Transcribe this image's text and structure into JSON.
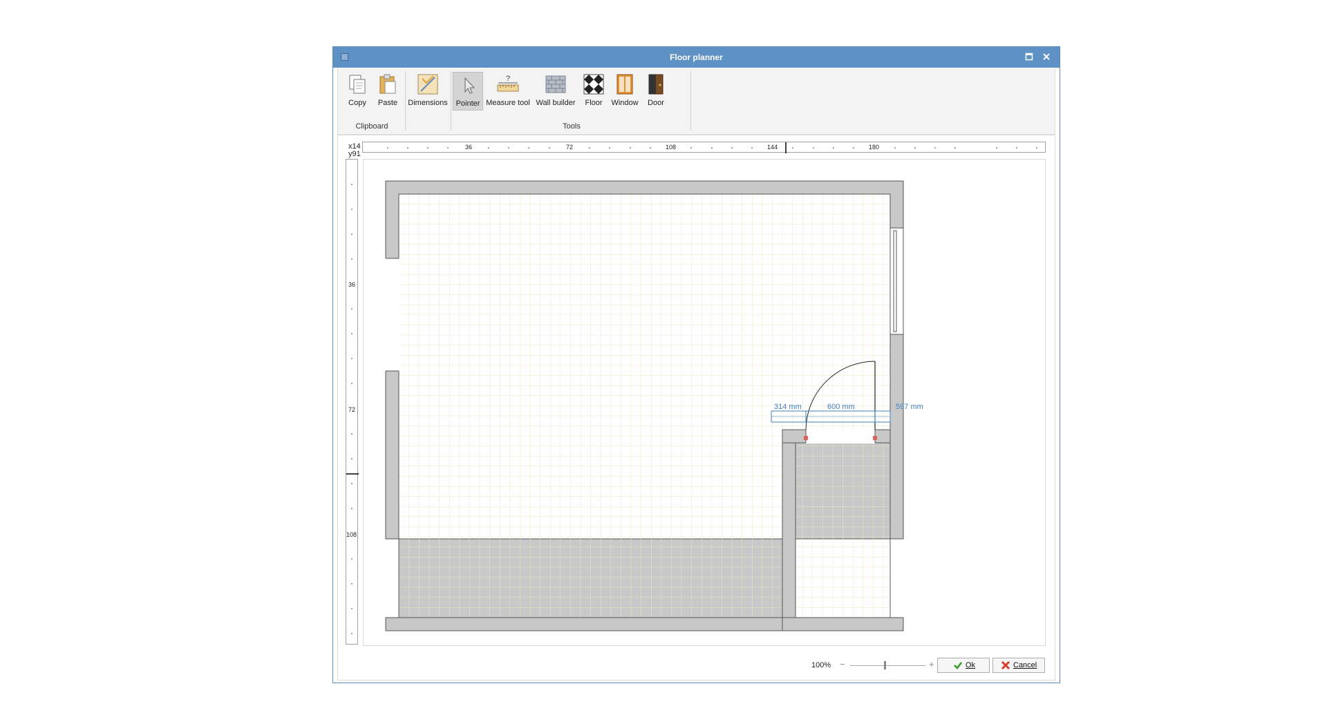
{
  "window": {
    "title": "Floor planner"
  },
  "ribbon": {
    "buttons": [
      {
        "label": "Copy",
        "icon": "copy-icon"
      },
      {
        "label": "Paste",
        "icon": "paste-icon"
      },
      {
        "label": "Dimensions",
        "icon": "dimensions-icon"
      },
      {
        "label": "Pointer",
        "icon": "pointer-icon",
        "active": true
      },
      {
        "label": "Measure tool",
        "icon": "measure-tool-icon"
      },
      {
        "label": "Wall builder",
        "icon": "wall-builder-icon"
      },
      {
        "label": "Floor",
        "icon": "floor-icon"
      },
      {
        "label": "Window",
        "icon": "window-icon"
      },
      {
        "label": "Door",
        "icon": "door-icon"
      }
    ],
    "groups": [
      "Clipboard",
      "Tools"
    ]
  },
  "coordinates": {
    "x": "x14",
    "y": "y91"
  },
  "ruler": {
    "horizontal_labels": [
      "36",
      "72",
      "108",
      "144",
      "180"
    ],
    "vertical_labels": [
      "36",
      "72",
      "108"
    ]
  },
  "dimensions": {
    "left": "314 mm",
    "door": "600 mm",
    "right": "597 mm"
  },
  "footer": {
    "zoom": "100%",
    "zoom_minus": "−",
    "zoom_plus": "+",
    "ok_label": "Ok",
    "cancel_label": "Cancel"
  },
  "colors": {
    "titlebar": "#5e92c5",
    "wall": "#c8c8c8",
    "grid": "#ece6c4",
    "dimension": "#3f7fbf",
    "handle": "#e06060"
  }
}
